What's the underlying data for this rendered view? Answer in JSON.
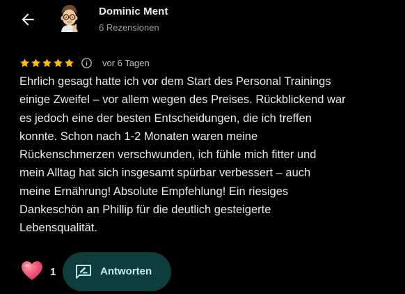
{
  "reviewer": {
    "name": "Dominic Ment",
    "meta": "6 Rezensionen",
    "avatar_icon": "memoji-avatar-icon"
  },
  "review": {
    "rating": 5,
    "rating_max": 5,
    "date": "vor 6 Tagen",
    "text": "Ehrlich gesagt hatte ich vor dem Start des Personal Trainings\neinige Zweifel – vor allem wegen des Preises. Rückblickend war\nes jedoch eine der besten Entscheidungen, die ich treffen\nkonnte. Schon nach 1-2 Monaten waren meine\nRückenschmerzen verschwunden, ich fühle mich fitter und\nmein Alltag hat sich insgesamt spürbar verbessert – auch\nmeine Ernährung! Absolute Empfehlung! Ein riesiges\nDankeschön an Phillip für die deutlich gesteigerte\nLebensqualität."
  },
  "actions": {
    "like_count": "1",
    "reply_label": "Antworten"
  },
  "colors": {
    "background": "#000000",
    "star": "#fbbc04",
    "heart": "#f25b78",
    "reply_bg": "#0e3d3d",
    "reply_fg": "#c4ece8"
  },
  "icons": {
    "back": "arrow-left-icon",
    "info": "info-icon",
    "like": "heart-icon",
    "reply": "reply-edit-icon"
  }
}
